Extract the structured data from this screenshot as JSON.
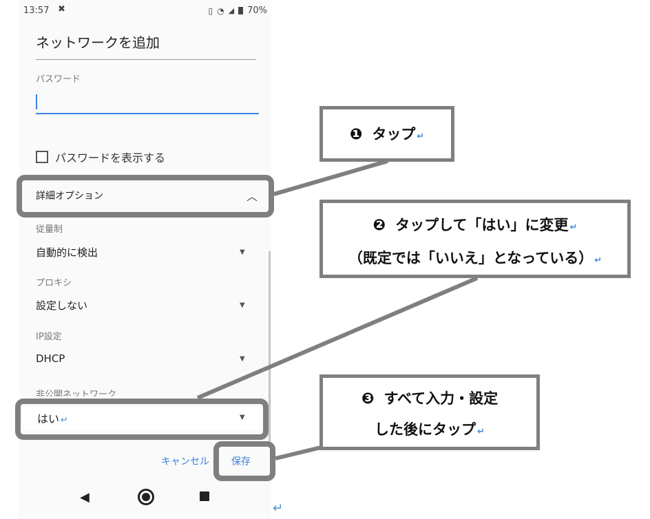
{
  "status_bar": {
    "time": "13:57",
    "bug_icon": "bug-icon",
    "battery": "70%"
  },
  "dialog": {
    "title": "ネットワークを追加",
    "password_label": "パスワード",
    "show_password_label": "パスワードを表示する",
    "advanced_options_label": "詳細オプション",
    "metered": {
      "label": "従量制",
      "value": "自動的に検出"
    },
    "proxy": {
      "label": "プロキシ",
      "value": "設定しない"
    },
    "ip_settings": {
      "label": "IP設定",
      "value": "DHCP"
    },
    "hidden_network": {
      "label": "非公開ネットワーク",
      "value": "はい"
    },
    "cancel_label": "キャンセル",
    "save_label": "保存"
  },
  "callouts": {
    "step1": {
      "number": "❶",
      "text": "タップ"
    },
    "step2": {
      "number": "❷",
      "line1": "タップして「はい」に変更",
      "line2": "（既定では「いいえ」となっている）"
    },
    "step3": {
      "number": "❸",
      "line1": "すべて入力・設定",
      "line2": "した後にタップ"
    }
  },
  "colors": {
    "accent": "#3b82e0",
    "highlight": "#7f7f7f",
    "return_mark": "#4c8fd6"
  },
  "return_mark": "↵"
}
